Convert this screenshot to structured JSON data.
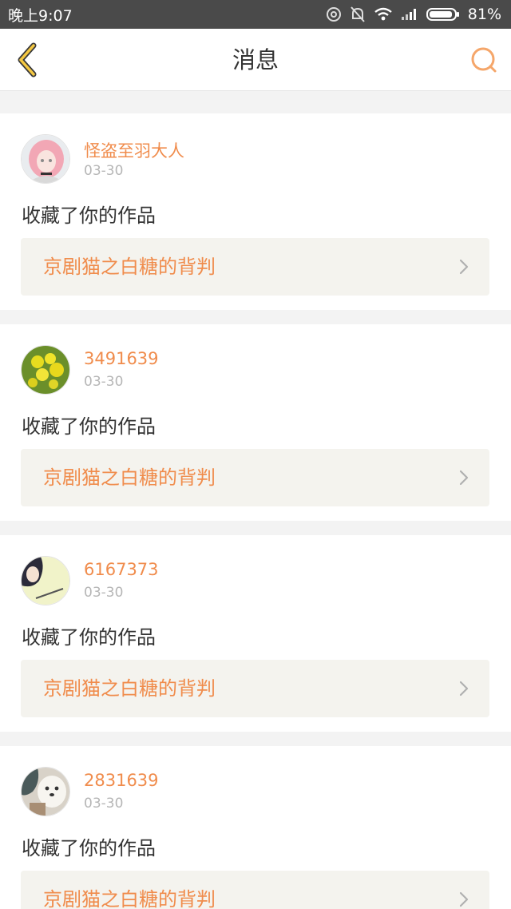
{
  "status_bar": {
    "time": "晚上9:07",
    "battery": "81%",
    "icons": [
      "nfc-icon",
      "mute-icon",
      "wifi-icon",
      "signal-icon",
      "battery-icon"
    ]
  },
  "header": {
    "title": "消息",
    "back_icon": "chevron-left-icon",
    "search_icon": "search-icon",
    "accent_color": "#f08c4c",
    "back_color": "#f5c842"
  },
  "messages": [
    {
      "user": "怪盗至羽大人",
      "date": "03-30",
      "action": "收藏了你的作品",
      "work": "京剧猫之白糖的背判"
    },
    {
      "user": "3491639",
      "date": "03-30",
      "action": "收藏了你的作品",
      "work": "京剧猫之白糖的背判"
    },
    {
      "user": "6167373",
      "date": "03-30",
      "action": "收藏了你的作品",
      "work": "京剧猫之白糖的背判"
    },
    {
      "user": "2831639",
      "date": "03-30",
      "action": "收藏了你的作品",
      "work": "京剧猫之白糖的背判"
    }
  ]
}
